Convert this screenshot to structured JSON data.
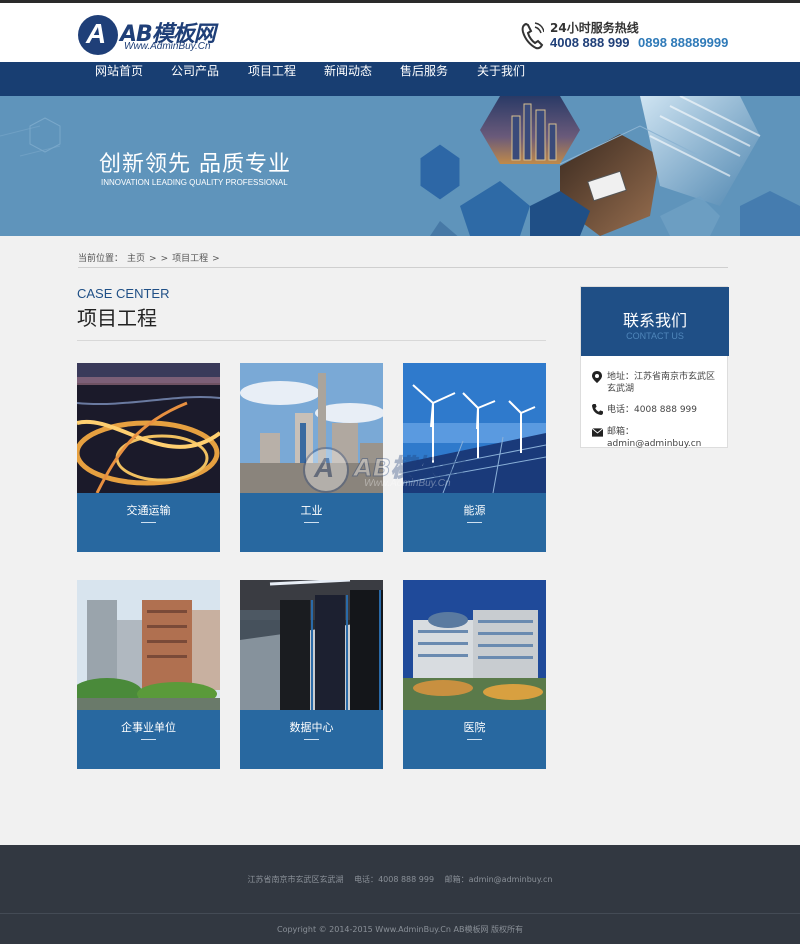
{
  "header": {
    "logo_letter": "A",
    "logo_title": "AB模板网",
    "logo_sub": "Www.AdminBuy.Cn",
    "hotline_label": "24小时服务热线",
    "hotline_number_1": "4008 888 999",
    "hotline_number_2": "0898 88889999",
    "icon": "phone-icon"
  },
  "nav": {
    "items": [
      {
        "label": "网站首页"
      },
      {
        "label": "公司产品"
      },
      {
        "label": "项目工程"
      },
      {
        "label": "新闻动态"
      },
      {
        "label": "售后服务"
      },
      {
        "label": "关于我们"
      }
    ]
  },
  "banner": {
    "title": "创新领先 品质专业",
    "subtitle": "INNOVATION LEADING QUALITY PROFESSIONAL"
  },
  "breadcrumb": {
    "prefix": "当前位置：",
    "home": "主页",
    "sep1": ">",
    "sep2": ">",
    "current": "项目工程",
    "sep3": ">"
  },
  "section": {
    "title_en": "CASE CENTER",
    "title_zh": "项目工程"
  },
  "cases": [
    {
      "label": "交通运输",
      "image": "highway-interchange-night"
    },
    {
      "label": "工业",
      "image": "industrial-plant"
    },
    {
      "label": "能源",
      "image": "wind-turbines-solar"
    },
    {
      "label": "企事业单位",
      "image": "office-buildings"
    },
    {
      "label": "数据中心",
      "image": "server-room"
    },
    {
      "label": "医院",
      "image": "hospital-building"
    }
  ],
  "contact": {
    "title": "联系我们",
    "subtitle": "CONTACT US",
    "address_label": "地址：",
    "address": "江苏省南京市玄武区玄武湖",
    "phone_label": "电话：",
    "phone": "4008 888 999",
    "email_label": "邮箱：",
    "email": "admin@adminbuy.cn",
    "icons": [
      "location-pin-icon",
      "phone-icon",
      "envelope-icon"
    ]
  },
  "footer": {
    "address": "江苏省南京市玄武区玄武湖",
    "phone_label": "电话：",
    "phone": "4008 888 999",
    "email_label": "邮箱：",
    "email": "admin@adminbuy.cn",
    "copyright": "Copyright © 2014-2015 Www.AdminBuy.Cn AB模板网 版权所有"
  },
  "watermark": {
    "letter": "A",
    "title": "AB模板网",
    "sub": "Www.AdminBuy.Cn"
  },
  "colors": {
    "brand_navy": "#183e72",
    "card_blue": "#2868a0",
    "banner_blue": "#5f94bb",
    "footer_bg": "#323841"
  }
}
